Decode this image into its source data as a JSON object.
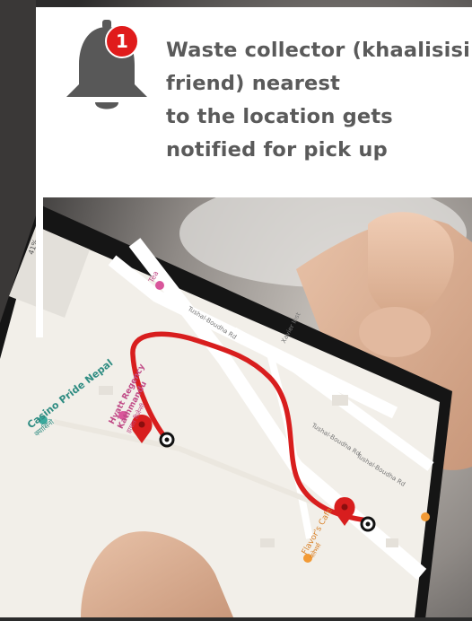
{
  "notification": {
    "badge_count": "1",
    "lines": [
      "Waste collector (khaalisisi",
      "friend) nearest",
      "to the location gets",
      "notified for pick up"
    ]
  },
  "phone": {
    "status_bar": "41%",
    "map": {
      "places": [
        {
          "name": "Casino Pride Nepal",
          "sub": "क्यासिनो"
        },
        {
          "name": "Hyatt Regency Kathmandu",
          "sub": "हायात रिजेन्सी"
        },
        {
          "name": "Flavor's Cafe",
          "sub": "फ्लेभर्स"
        },
        {
          "name": "Tea",
          "sub": ""
        }
      ],
      "roads": [
        "Tushal-Boudha Rd",
        "Xavier Inst",
        "Tushal-Boudha Rd",
        "Tushal-Boudha Rd"
      ]
    }
  },
  "colors": {
    "route": "#d81e1e",
    "badge": "#e01b1b",
    "bell": "#585858",
    "text": "#5a5a5a",
    "map_bg": "#f2efe9",
    "road": "#ffffff"
  }
}
